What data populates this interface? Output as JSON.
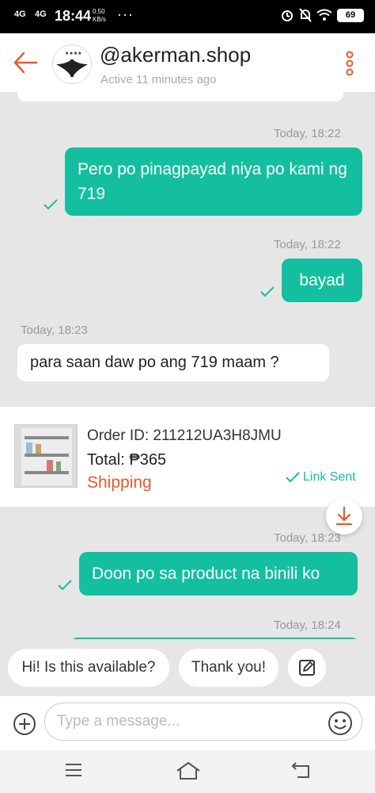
{
  "status_bar": {
    "network1": "4G",
    "network2": "4G",
    "time": "18:44",
    "speed_value": "0.50",
    "speed_unit": "KB/s",
    "more": "···",
    "battery": "69",
    "icons": [
      "alarm-icon",
      "mute-icon",
      "wifi-icon",
      "battery-icon"
    ]
  },
  "header": {
    "shop_name": "@akerman.shop",
    "active_status": "Active 11 minutes ago"
  },
  "messages": [
    {
      "direction": "out",
      "timestamp": "Today, 18:22",
      "text": "Pero po pinagpayad niya po kami ng 719",
      "read": true
    },
    {
      "direction": "out",
      "timestamp": "Today, 18:22",
      "text": "bayad",
      "read": true
    },
    {
      "direction": "in",
      "timestamp": "Today, 18:23",
      "text": "para saan daw po ang 719 maam ?"
    },
    {
      "direction": "out",
      "timestamp": "Today, 18:23",
      "text": "Doon po sa product na binili ko",
      "read": true
    },
    {
      "direction": "out",
      "timestamp": "Today, 18:24",
      "text": ""
    }
  ],
  "order_card": {
    "order_id": "Order ID: 211212UA3H8JMU",
    "total": "Total: ₱365",
    "status": "Shipping",
    "link_status": "Link Sent"
  },
  "quick_replies": [
    "Hi! Is this available?",
    "Thank you!"
  ],
  "input": {
    "placeholder": "Type a message..."
  },
  "colors": {
    "accent": "#13bf9f",
    "brand_orange": "#e8572f",
    "background": "#e6e6e6"
  }
}
